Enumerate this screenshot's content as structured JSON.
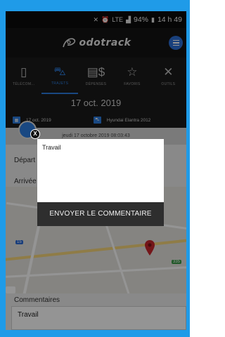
{
  "status_bar": {
    "icons": [
      "mute-icon",
      "alarm-icon",
      "lte-icon",
      "signal-icon",
      "battery-icon"
    ],
    "lte": "LTE",
    "battery": "94%",
    "time": "14 h 49"
  },
  "app": {
    "name": "odotrack",
    "accent": "#2b7de0"
  },
  "tabs": [
    {
      "label": "TÉLÉCOM...",
      "icon": "phone-icon",
      "active": false
    },
    {
      "label": "TRAJETS",
      "icon": "car-icon",
      "active": true
    },
    {
      "label": "DÉPENSES",
      "icon": "money-icon",
      "active": false
    },
    {
      "label": "FAVORIS",
      "icon": "star-icon",
      "active": false
    },
    {
      "label": "OUTILS",
      "icon": "tools-icon",
      "active": false
    }
  ],
  "header": {
    "date": "17 oct. 2019",
    "info_date": "17 oct. 2019",
    "vehicle": "Hyundai Elantra 2012"
  },
  "trip": {
    "timestamp": "jeudi 17 octobre 2019 08:03:43"
  },
  "form": {
    "departure_label": "Départ",
    "arrival_label": "Arrivée",
    "comments_label": "Commentaires",
    "comments_value": "Travail"
  },
  "map": {
    "shield_a": "15",
    "shield_b": "335"
  },
  "modal": {
    "input_value": "Travail",
    "send_label": "ENVOYER LE COMMENTAIRE",
    "close_label": "X"
  }
}
